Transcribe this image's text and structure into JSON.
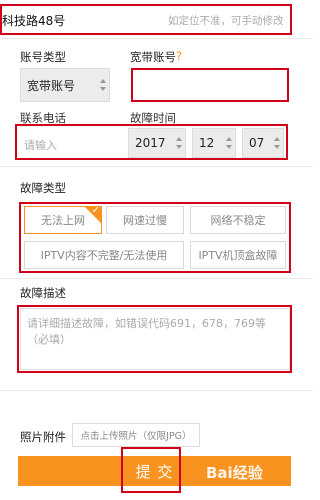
{
  "address": {
    "value": "科技路48号",
    "hint": "如定位不准，可手动修改"
  },
  "account": {
    "type_label": "账号类型",
    "type_value": "宽带账号",
    "number_label": "宽带账号",
    "help_mark": "?"
  },
  "contact": {
    "label": "联系电话",
    "placeholder": "请输入"
  },
  "fault_time": {
    "label": "故障时间",
    "year": "2017",
    "month": "12",
    "day": "07"
  },
  "fault_type": {
    "label": "故障类型",
    "options": [
      "无法上网",
      "网速过慢",
      "网络不稳定",
      "IPTV内容不完整/无法使用",
      "IPTV机顶盒故障"
    ],
    "selected": "无法上网"
  },
  "description": {
    "label": "故障描述",
    "placeholder": "请详细描述故障，如错误代码691，678，769等（必填）"
  },
  "photo": {
    "label": "照片附件",
    "button": "点击上传照片（仅限JPG）"
  },
  "submit": {
    "label": "提 交"
  },
  "watermark": "Bai经验",
  "colors": {
    "accent": "#f7931e",
    "highlight_box": "#d0021b",
    "submit_bg": "#f7931e"
  }
}
